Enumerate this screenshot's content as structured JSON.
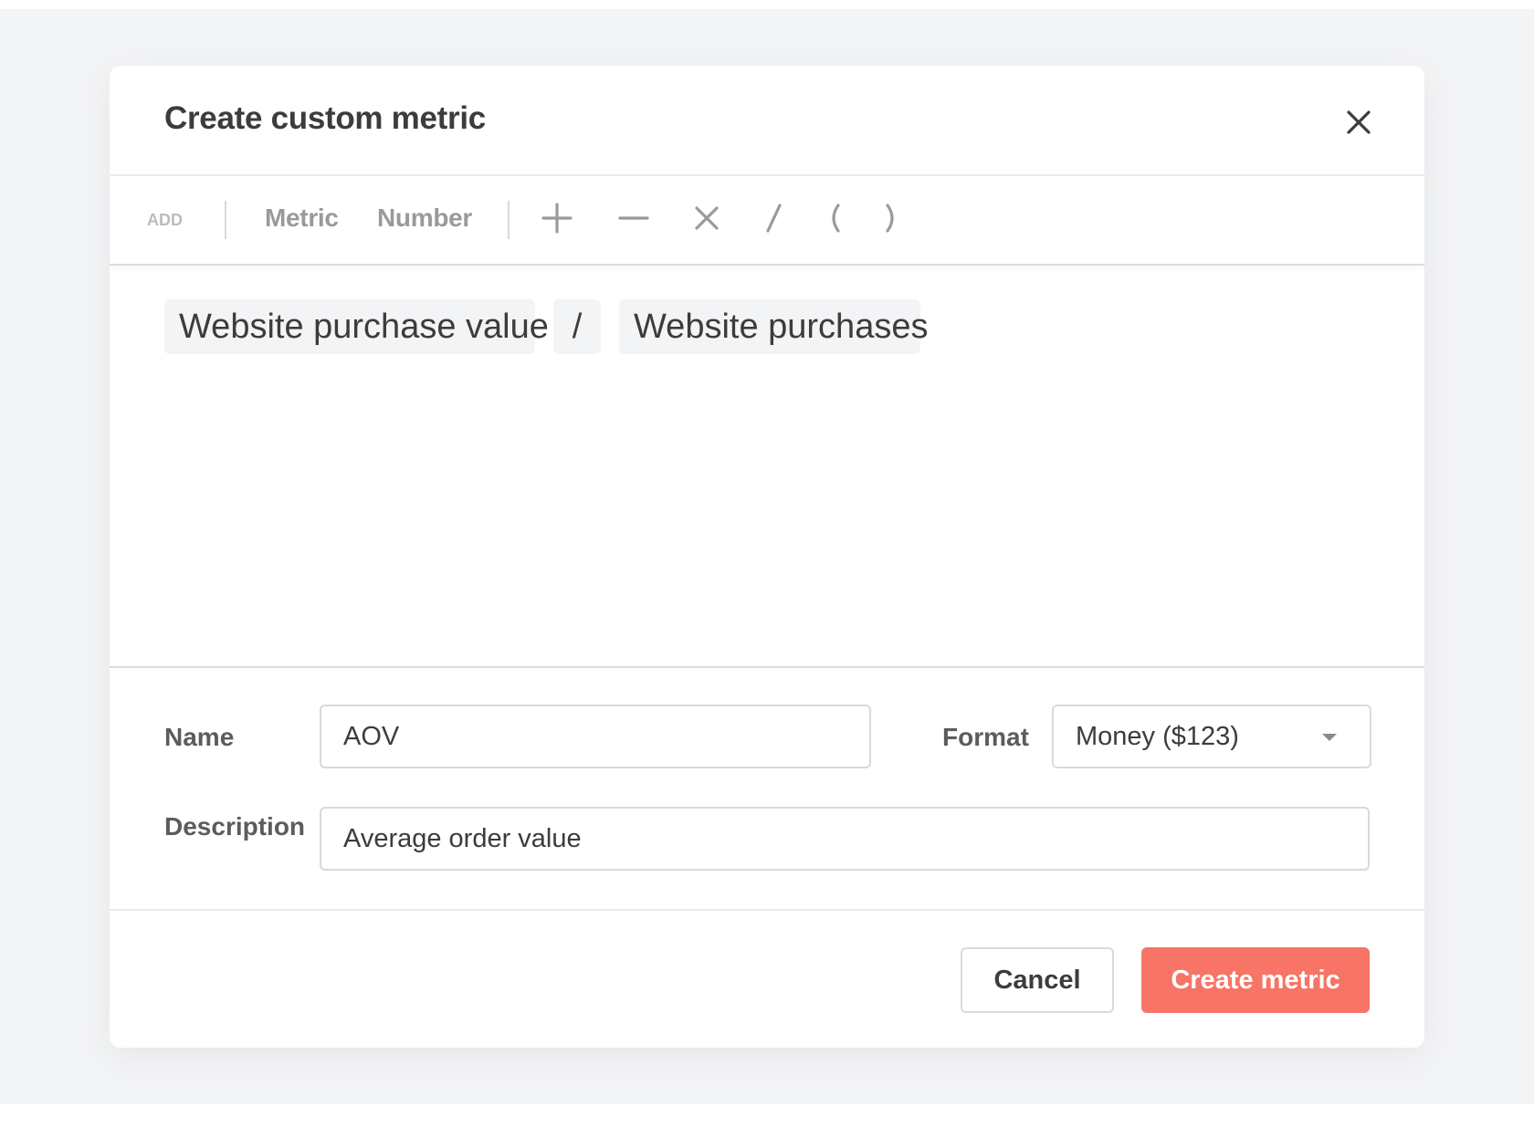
{
  "dialog": {
    "title": "Create custom metric",
    "close_icon": "close-icon"
  },
  "toolbar": {
    "add_label": "ADD",
    "items": [
      {
        "label": "Metric"
      },
      {
        "label": "Number"
      }
    ],
    "operators": [
      {
        "name": "plus",
        "symbol": "+"
      },
      {
        "name": "minus",
        "symbol": "−"
      },
      {
        "name": "multiply",
        "symbol": "×"
      },
      {
        "name": "divide",
        "symbol": "/"
      },
      {
        "name": "open-paren",
        "symbol": "("
      },
      {
        "name": "close-paren",
        "symbol": ")"
      }
    ]
  },
  "formula": {
    "tokens": [
      {
        "type": "metric",
        "label": "Website purchase value"
      },
      {
        "type": "operator",
        "label": "/"
      },
      {
        "type": "metric",
        "label": "Website purchases"
      }
    ]
  },
  "form": {
    "name_label": "Name",
    "name_value": "AOV",
    "format_label": "Format",
    "format_value": "Money ($123)",
    "description_label": "Description",
    "description_value": "Average order value"
  },
  "footer": {
    "cancel_label": "Cancel",
    "create_label": "Create metric"
  },
  "colors": {
    "primary": "#f77466",
    "text": "#3d3b3c",
    "muted": "#9a9a9a",
    "backdrop": "#f3f4f6"
  }
}
